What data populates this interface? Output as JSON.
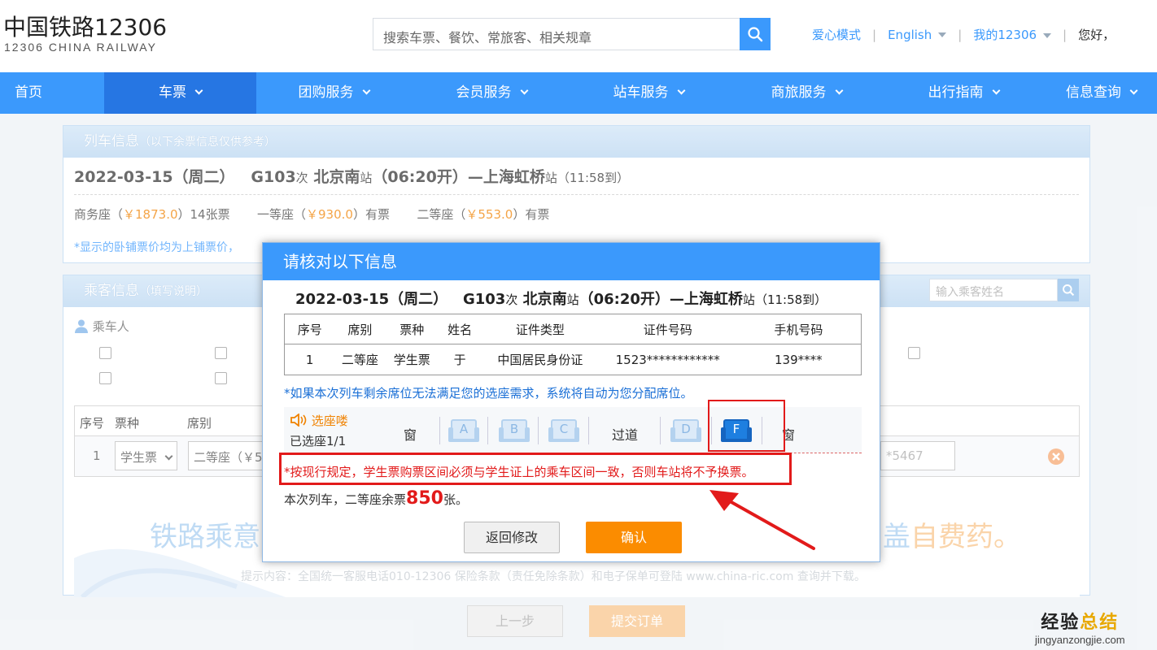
{
  "header": {
    "logo_cn": "中国铁路12306",
    "logo_en": "12306 CHINA RAILWAY",
    "search_placeholder": "搜索车票、餐饮、常旅客、相关规章",
    "links": {
      "care_mode": "爱心模式",
      "english": "English",
      "my12306": "我的12306",
      "hello": "您好，"
    }
  },
  "nav": {
    "items": [
      "首页",
      "车票",
      "团购服务",
      "会员服务",
      "站车服务",
      "商旅服务",
      "出行指南",
      "信息查询"
    ]
  },
  "train_panel": {
    "title": "列车信息",
    "title_note": "（以下余票信息仅供参考）",
    "date": "2022-03-15（周二）",
    "train_no": "G103",
    "ci": "次",
    "from": "北京南",
    "zhan": "站",
    "depart": "（06:20开）—",
    "to": "上海虹桥",
    "arrive": "（11:58到）",
    "prices": {
      "business_label": "商务座（",
      "business_price": "￥1873.0",
      "business_rest": "）14张票",
      "first_label": "一等座（",
      "first_price": "￥930.0",
      "first_rest": "）有票",
      "second_label": "二等座（",
      "second_price": "￥553.0",
      "second_rest": "）有票"
    },
    "note": "*显示的卧铺票价均为上铺票价，"
  },
  "passenger_panel": {
    "title": "乘客信息",
    "title_note": "（填写说明）",
    "search_placeholder": "输入乘客姓名",
    "passenger_label": "乘车人",
    "row_head": [
      "序号",
      "票种",
      "席别"
    ],
    "row": {
      "index": "1",
      "ticket_type": "学生票",
      "seat": "二等座（￥5",
      "phone_tail": "*5467"
    },
    "banner_left": "铁路乘意",
    "banner_right_blue": "盖",
    "banner_right_orange": "自费药。",
    "banner_small": "提示内容：全国统一客服电话010-12306 保险条款（责任免除条款）和电子保单可登陆 www.china-ric.com 查询并下载。"
  },
  "bottom_buttons": {
    "prev": "上一步",
    "submit": "提交订单"
  },
  "modal": {
    "title": "请核对以下信息",
    "train_line": {
      "date": "2022-03-15（周二）",
      "train_no": "G103",
      "ci": "次",
      "from": "北京南",
      "zhan": "站",
      "depart": "（06:20开）—",
      "to": "上海虹桥",
      "arrive": "（11:58到）"
    },
    "table_headers": [
      "序号",
      "席别",
      "票种",
      "姓名",
      "证件类型",
      "证件号码",
      "手机号码"
    ],
    "table_row": [
      "1",
      "二等座",
      "学生票",
      "于",
      "中国居民身份证",
      "1523************",
      "139****"
    ],
    "seat_note": "*如果本次列车剩余席位无法满足您的选座需求，系统将自动为您分配席位。",
    "seat_picker": {
      "tag": "选座喽",
      "count": "已选座1/1",
      "window_left": "窗",
      "aisle": "过道",
      "window_right": "窗",
      "seats": [
        "A",
        "B",
        "C",
        "D",
        "F"
      ],
      "selected": "F"
    },
    "warning": "*按现行规定，学生票购票区间必须与学生证上的乘车区间一致，否则车站将不予换票。",
    "remain_prefix": "本次列车，二等座余票",
    "remain_count": "850",
    "remain_suffix": "张。",
    "back_button": "返回修改",
    "confirm_button": "确认"
  },
  "watermark": {
    "line1_a": "经验",
    "line1_b": "总结",
    "line2": "jingyanzongjie.com"
  },
  "colors": {
    "primary": "#3b99fc",
    "nav_active": "#2676e3",
    "orange": "#fb8c00",
    "warning_red": "#e21a1a"
  }
}
